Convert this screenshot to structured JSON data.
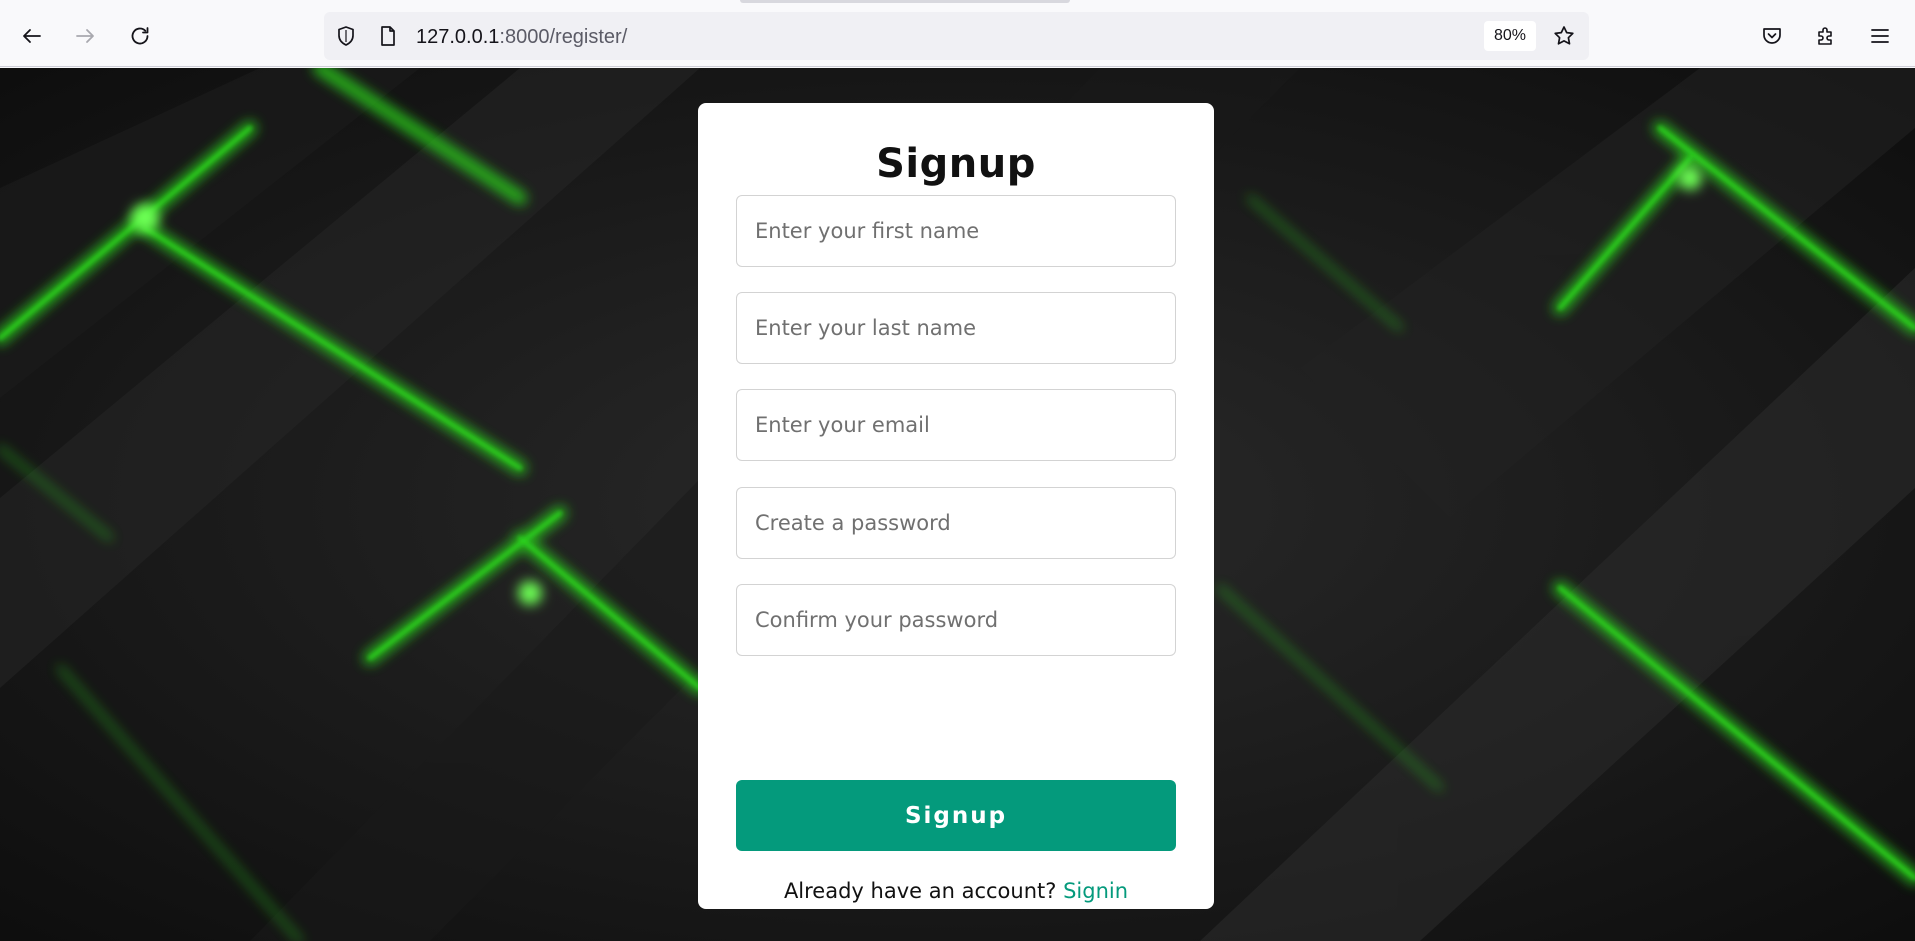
{
  "browser": {
    "url_host": "127.0.0.1",
    "url_path": ":8000/register/",
    "zoom": "80%",
    "icons": {
      "back": "back-arrow-icon",
      "forward": "forward-arrow-icon",
      "reload": "reload-icon",
      "shield": "tracking-protection-shield-icon",
      "page": "page-info-icon",
      "bookmark": "bookmark-star-icon",
      "pocket": "pocket-icon",
      "extensions": "extensions-puzzle-icon",
      "menu": "hamburger-menu-icon"
    }
  },
  "form": {
    "title": "Signup",
    "fields": {
      "first_name_placeholder": "Enter your first name",
      "last_name_placeholder": "Enter your last name",
      "email_placeholder": "Enter your email",
      "password_placeholder": "Create a password",
      "confirm_password_placeholder": "Confirm your password"
    },
    "submit_label": "Signup",
    "signin_prompt": "Already have an account?",
    "signin_link": "Signin"
  },
  "colors": {
    "accent": "#049a7c",
    "background_dark": "#141414",
    "background_glow": "#2bd41f",
    "card": "#ffffff"
  }
}
